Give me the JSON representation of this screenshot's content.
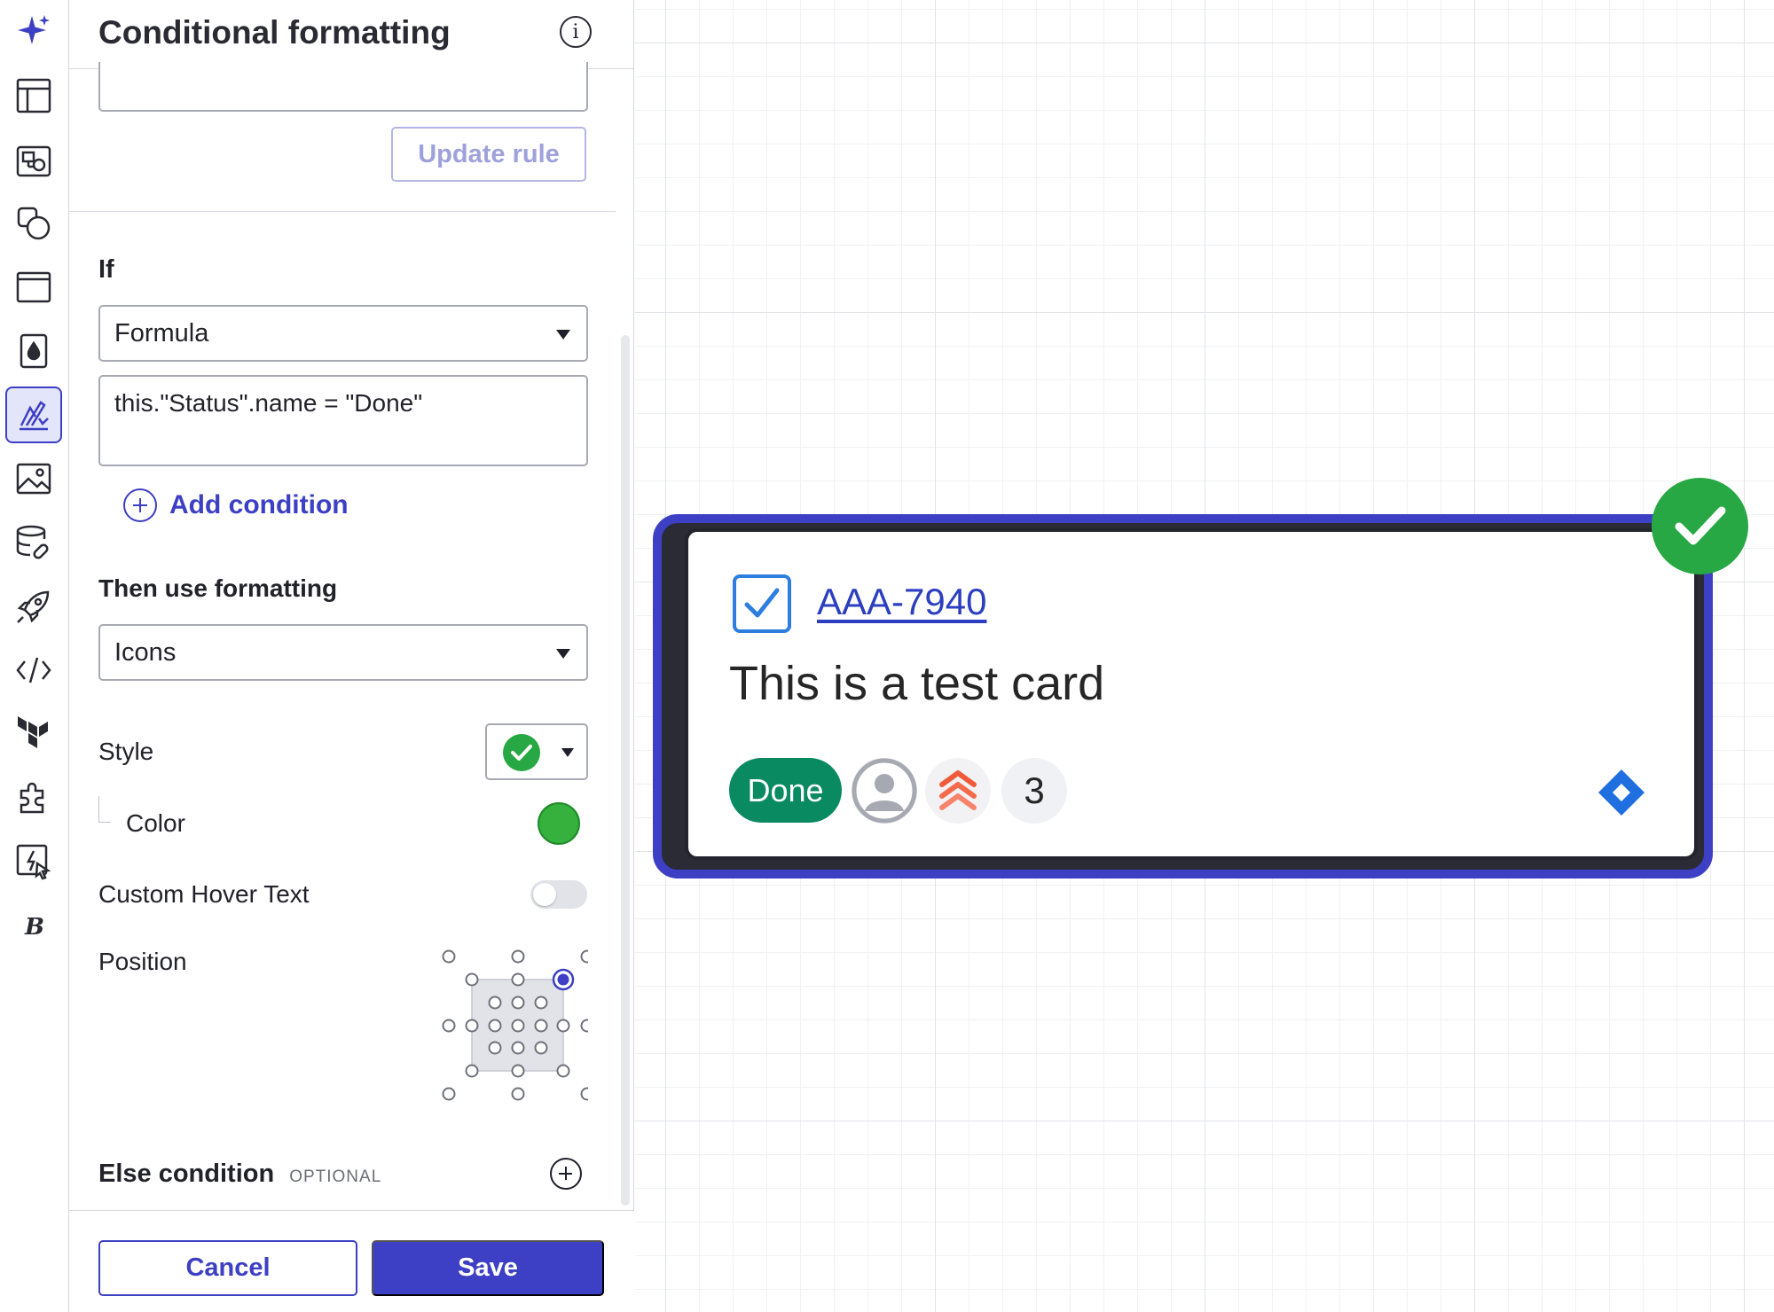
{
  "panel": {
    "title": "Conditional formatting",
    "update_rule_label": "Update rule",
    "if_label": "If",
    "condition_type": "Formula",
    "formula": "this.\"Status\".name = \"Done\"",
    "add_condition_label": "Add condition",
    "then_label": "Then use formatting",
    "formatting_type": "Icons",
    "style_label": "Style",
    "style_value_icon": "check-circle-icon",
    "color_label": "Color",
    "color_value": "#36b13d",
    "hover_text_label": "Custom Hover Text",
    "hover_text_enabled": false,
    "position_label": "Position",
    "position_selected": "top-right",
    "else_label": "Else condition",
    "else_optional": "OPTIONAL",
    "cancel_label": "Cancel",
    "save_label": "Save"
  },
  "rail": {
    "items": [
      "sparkle-icon",
      "table-layout-icon",
      "shape-library-icon",
      "shapes-icon",
      "container-icon",
      "fill-drop-icon",
      "conditional-formatting-icon",
      "image-icon",
      "data-link-icon",
      "rocket-icon",
      "code-icon",
      "terraform-icon",
      "extension-puzzle-icon",
      "action-icon",
      "bold-b-icon"
    ],
    "active": "conditional-formatting-icon"
  },
  "card": {
    "issue_key": "AAA-7940",
    "title": "This is a test card",
    "status": "Done",
    "status_color": "#0a8a60",
    "story_points": "3",
    "badge_color": "#27a844",
    "selection_color": "#3d3fc4"
  },
  "colors": {
    "accent": "#3d3fc4"
  }
}
